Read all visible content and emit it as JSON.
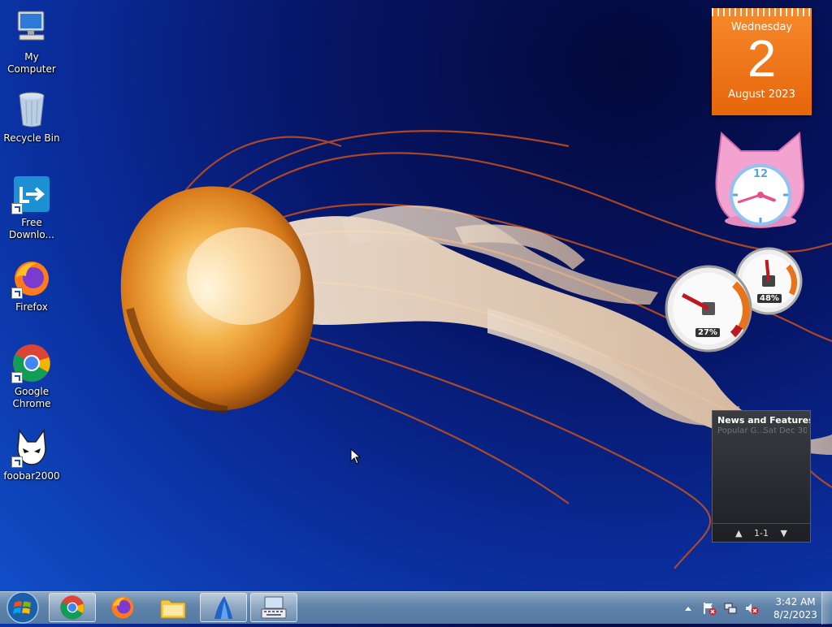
{
  "desktop_icons": [
    {
      "label": "My Computer",
      "icon": "computer-icon"
    },
    {
      "label": "Recycle Bin",
      "icon": "recycle-bin-icon"
    },
    {
      "label": "Free Downlo...",
      "label_line1": "Free",
      "label_line2": "Downlo...",
      "icon": "free-download-manager-icon"
    },
    {
      "label": "Firefox",
      "icon": "firefox-icon"
    },
    {
      "label": "Google Chrome",
      "label_line1": "Google",
      "label_line2": "Chrome",
      "icon": "chrome-icon"
    },
    {
      "label": "foobar2000",
      "icon": "foobar2000-icon"
    }
  ],
  "gadgets": {
    "calendar": {
      "weekday": "Wednesday",
      "day": "2",
      "month_year": "August 2023",
      "color": "#f07a1a"
    },
    "clock": {
      "hour": 3,
      "minute": 42,
      "number": "12"
    },
    "cpu_meter": {
      "cpu": "27%",
      "memory": "48%",
      "cpu_value": 27,
      "memory_value": 48
    },
    "feed": {
      "headline": "News and Features f...",
      "source": "Popular G...",
      "date": "Sat Dec 30",
      "page": "1-1"
    }
  },
  "taskbar": {
    "start_icon": "windows-logo-icon",
    "buttons": [
      {
        "name": "chrome",
        "icon": "chrome-icon",
        "open": true
      },
      {
        "name": "firefox",
        "icon": "firefox-icon",
        "open": false
      },
      {
        "name": "file-explorer",
        "icon": "folder-icon",
        "open": false
      },
      {
        "name": "app",
        "icon": "blue-sail-icon",
        "open": true
      },
      {
        "name": "on-screen-keyboard",
        "icon": "keyboard-icon",
        "open": true
      }
    ],
    "tray": {
      "icons": [
        "show-hidden-icons-chevron",
        "action-center-flag-icon",
        "network-icon",
        "volume-muted-icon"
      ],
      "time": "3:42 AM",
      "date": "8/2/2023"
    }
  }
}
